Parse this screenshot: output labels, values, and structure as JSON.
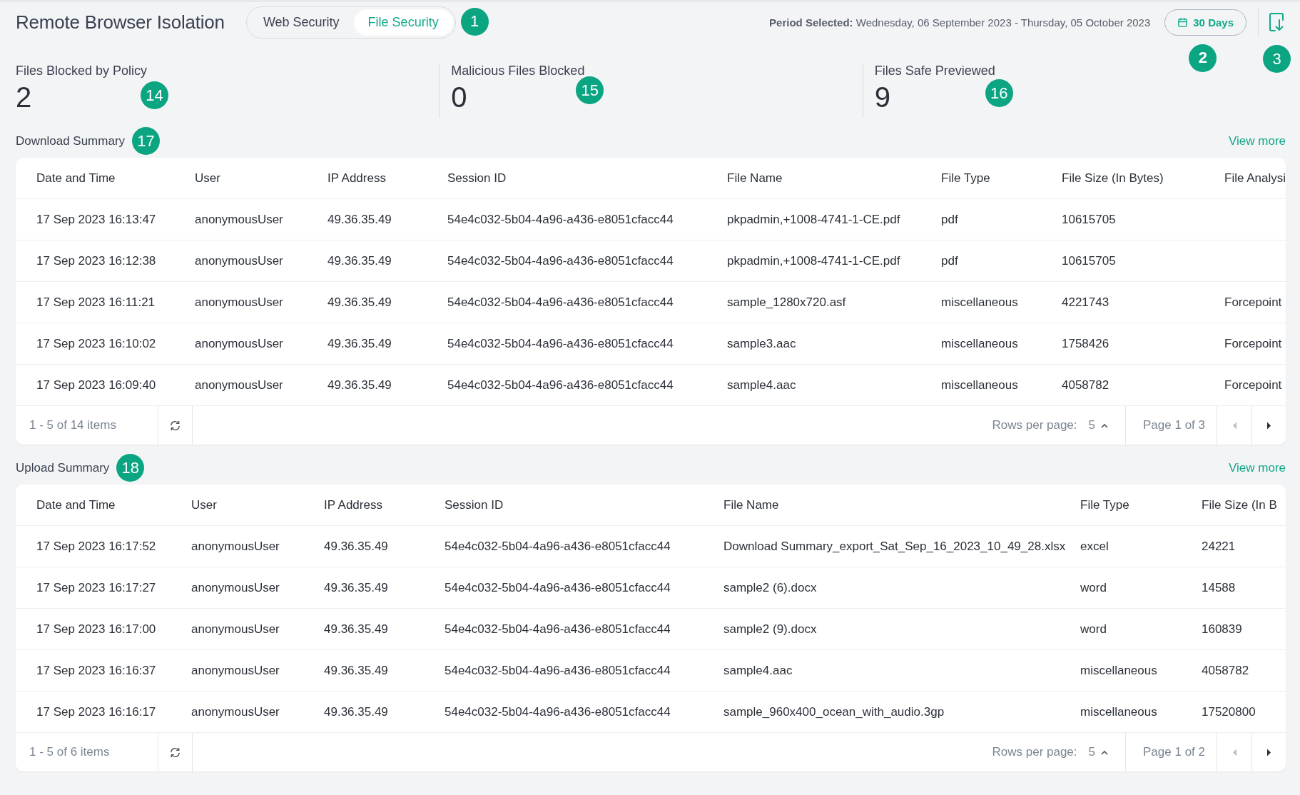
{
  "header": {
    "title": "Remote Browser Isolation",
    "tabs": [
      {
        "label": "Web Security",
        "selected": false
      },
      {
        "label": "File Security",
        "selected": true
      }
    ],
    "callout": "1",
    "period_label": "Period Selected:",
    "period_value": "Wednesday, 06 September 2023 - Thursday, 05 October 2023",
    "range_button": {
      "label": "30 Days",
      "callout": "2"
    },
    "export_callout": "3"
  },
  "stats": [
    {
      "label": "Files Blocked by Policy",
      "value": "2",
      "callout": "14"
    },
    {
      "label": "Malicious Files Blocked",
      "value": "0",
      "callout": "15"
    },
    {
      "label": "Files Safe Previewed",
      "value": "9",
      "callout": "16"
    }
  ],
  "tables": [
    {
      "title": "Download Summary",
      "callout": "17",
      "view_more": "View more",
      "columns": [
        "Date and Time",
        "User",
        "IP Address",
        "Session ID",
        "File Name",
        "File Type",
        "File Size (In Bytes)",
        "File Analysi"
      ],
      "rows": [
        [
          "17 Sep 2023 16:13:47",
          "anonymousUser",
          "49.36.35.49",
          "54e4c032-5b04-4a96-a436-e8051cfacc44",
          "pkpadmin,+1008-4741-1-CE.pdf",
          "pdf",
          "10615705",
          null
        ],
        [
          "17 Sep 2023 16:12:38",
          "anonymousUser",
          "49.36.35.49",
          "54e4c032-5b04-4a96-a436-e8051cfacc44",
          "pkpadmin,+1008-4741-1-CE.pdf",
          "pdf",
          "10615705",
          null
        ],
        [
          "17 Sep 2023 16:11:21",
          "anonymousUser",
          "49.36.35.49",
          "54e4c032-5b04-4a96-a436-e8051cfacc44",
          "sample_1280x720.asf",
          "miscellaneous",
          "4221743",
          "Forcepoint"
        ],
        [
          "17 Sep 2023 16:10:02",
          "anonymousUser",
          "49.36.35.49",
          "54e4c032-5b04-4a96-a436-e8051cfacc44",
          "sample3.aac",
          "miscellaneous",
          "1758426",
          "Forcepoint"
        ],
        [
          "17 Sep 2023 16:09:40",
          "anonymousUser",
          "49.36.35.49",
          "54e4c032-5b04-4a96-a436-e8051cfacc44",
          "sample4.aac",
          "miscellaneous",
          "4058782",
          "Forcepoint"
        ]
      ],
      "footer": {
        "items": "1 - 5 of 14 items",
        "rows_per_page_label": "Rows per page:",
        "rows_per_page": "5",
        "page": "Page 1 of 3"
      }
    },
    {
      "title": "Upload Summary",
      "callout": "18",
      "view_more": "View more",
      "columns": [
        "Date and Time",
        "User",
        "IP Address",
        "Session ID",
        "File Name",
        "File Type",
        "File Size (In B"
      ],
      "rows": [
        [
          "17 Sep 2023 16:17:52",
          "anonymousUser",
          "49.36.35.49",
          "54e4c032-5b04-4a96-a436-e8051cfacc44",
          "Download Summary_export_Sat_Sep_16_2023_10_49_28.xlsx",
          "excel",
          "24221"
        ],
        [
          "17 Sep 2023 16:17:27",
          "anonymousUser",
          "49.36.35.49",
          "54e4c032-5b04-4a96-a436-e8051cfacc44",
          "sample2 (6).docx",
          "word",
          "14588"
        ],
        [
          "17 Sep 2023 16:17:00",
          "anonymousUser",
          "49.36.35.49",
          "54e4c032-5b04-4a96-a436-e8051cfacc44",
          "sample2 (9).docx",
          "word",
          "160839"
        ],
        [
          "17 Sep 2023 16:16:37",
          "anonymousUser",
          "49.36.35.49",
          "54e4c032-5b04-4a96-a436-e8051cfacc44",
          "sample4.aac",
          "miscellaneous",
          "4058782"
        ],
        [
          "17 Sep 2023 16:16:17",
          "anonymousUser",
          "49.36.35.49",
          "54e4c032-5b04-4a96-a436-e8051cfacc44",
          "sample_960x400_ocean_with_audio.3gp",
          "miscellaneous",
          "17520800"
        ]
      ],
      "footer": {
        "items": "1 - 5 of 6 items",
        "rows_per_page_label": "Rows per page:",
        "rows_per_page": "5",
        "page": "Page 1 of 2"
      }
    }
  ]
}
